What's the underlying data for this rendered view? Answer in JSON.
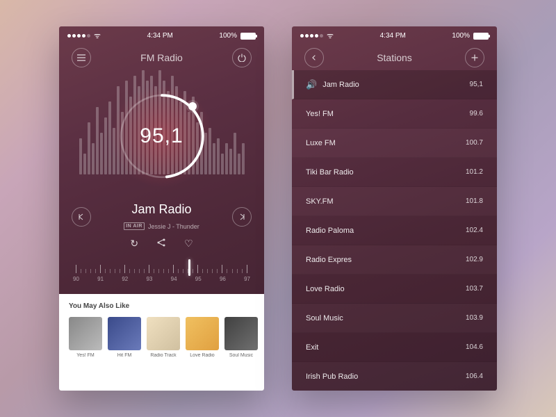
{
  "statusbar": {
    "time": "4:34 PM",
    "battery": "100%"
  },
  "left": {
    "title": "FM Radio",
    "frequency": "95,1",
    "station": "Jam Radio",
    "in_air": "IN AIR",
    "track": "Jessie J - Thunder",
    "scale": [
      "90",
      "91",
      "92",
      "93",
      "94",
      "95",
      "96",
      "97"
    ],
    "suggest_title": "You May Also Like",
    "suggest": [
      {
        "label": "Yes! FM"
      },
      {
        "label": "Hit FM"
      },
      {
        "label": "Radio Track"
      },
      {
        "label": "Love Radio"
      },
      {
        "label": "Soul Music"
      }
    ]
  },
  "right": {
    "title": "Stations",
    "stations": [
      {
        "name": "Jam Radio",
        "freq": "95,1",
        "active": true
      },
      {
        "name": "Yes! FM",
        "freq": "99.6"
      },
      {
        "name": "Luxe FM",
        "freq": "100.7"
      },
      {
        "name": "Tiki Bar Radio",
        "freq": "101.2"
      },
      {
        "name": "SKY.FM",
        "freq": "101.8"
      },
      {
        "name": "Radio Paloma",
        "freq": "102.4"
      },
      {
        "name": "Radio Expres",
        "freq": "102.9"
      },
      {
        "name": "Love Radio",
        "freq": "103.7"
      },
      {
        "name": "Soul Music",
        "freq": "103.9"
      },
      {
        "name": "Exit",
        "freq": "104.6"
      },
      {
        "name": "Irish Pub Radio",
        "freq": "106.4"
      }
    ]
  }
}
